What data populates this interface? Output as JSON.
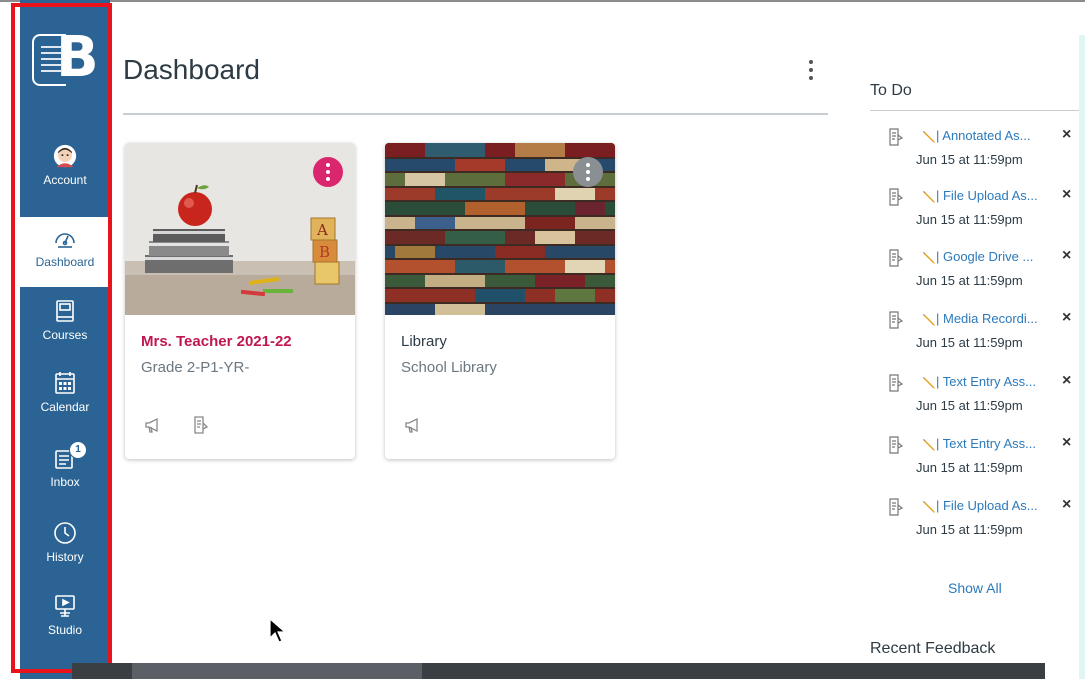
{
  "app": {
    "page_title": "Dashboard"
  },
  "nav": {
    "items": [
      {
        "label": "Account",
        "icon": "account-avatar-icon"
      },
      {
        "label": "Dashboard",
        "icon": "dashboard-icon",
        "active": true
      },
      {
        "label": "Courses",
        "icon": "courses-icon"
      },
      {
        "label": "Calendar",
        "icon": "calendar-icon"
      },
      {
        "label": "Inbox",
        "icon": "inbox-icon",
        "badge": "1"
      },
      {
        "label": "History",
        "icon": "history-clock-icon"
      },
      {
        "label": "Studio",
        "icon": "studio-icon"
      }
    ]
  },
  "cards": [
    {
      "title": "Mrs. Teacher 2021-22",
      "subtitle": "Grade 2-P1-YR-",
      "title_color": "#c0174f",
      "menu_color": "#d9266c"
    },
    {
      "title": "Library",
      "subtitle": "School Library",
      "title_color": "#2d3b45",
      "menu_color": "#8a8f93"
    }
  ],
  "todo": {
    "title": "To Do",
    "items": [
      {
        "link": "| Annotated As...",
        "date": "Jun 15 at 11:59pm"
      },
      {
        "link": "| File Upload As...",
        "date": "Jun 15 at 11:59pm"
      },
      {
        "link": "| Google Drive ...",
        "date": "Jun 15 at 11:59pm"
      },
      {
        "link": "| Media Recordi...",
        "date": "Jun 15 at 11:59pm"
      },
      {
        "link": "| Text Entry Ass...",
        "date": "Jun 15 at 11:59pm"
      },
      {
        "link": "| Text Entry Ass...",
        "date": "Jun 15 at 11:59pm"
      },
      {
        "link": "| File Upload As...",
        "date": "Jun 15 at 11:59pm"
      }
    ],
    "close_symbol": "×",
    "show_all": "Show All"
  },
  "recent_feedback": {
    "title": "Recent Feedback"
  },
  "colors": {
    "nav_bg": "#2b6494",
    "highlight_border": "#e8131b",
    "link": "#2b7abc"
  }
}
